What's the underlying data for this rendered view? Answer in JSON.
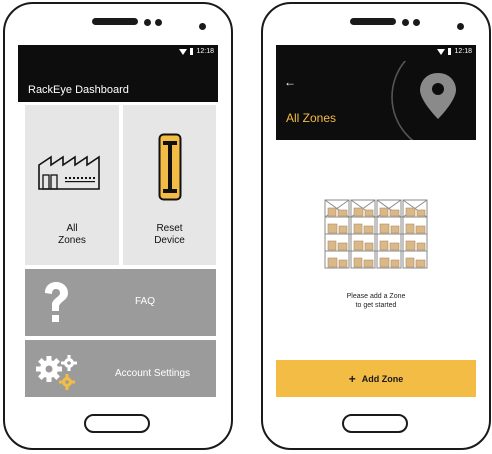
{
  "left": {
    "status_time": "12:18",
    "app_title": "RackEye Dashboard",
    "tiles": {
      "all_zones": "All\nZones",
      "reset_device": "Reset\nDevice",
      "faq": "FAQ",
      "account_settings": "Account Settings"
    }
  },
  "right": {
    "status_time": "12:18",
    "back_glyph": "←",
    "title": "All Zones",
    "empty_message_line1": "Please add a Zone",
    "empty_message_line2": "to get started",
    "add_zone_plus": "+",
    "add_zone_label": "Add Zone"
  },
  "colors": {
    "accent": "#f3bc45",
    "tile_light": "#e6e6e6",
    "tile_dark": "#9b9b9b",
    "bar_dark": "#0d0d0d"
  },
  "icons": [
    "factory-icon",
    "reset-device-icon",
    "question-icon",
    "gears-icon",
    "location-pin-icon",
    "warehouse-racks-illustration"
  ]
}
